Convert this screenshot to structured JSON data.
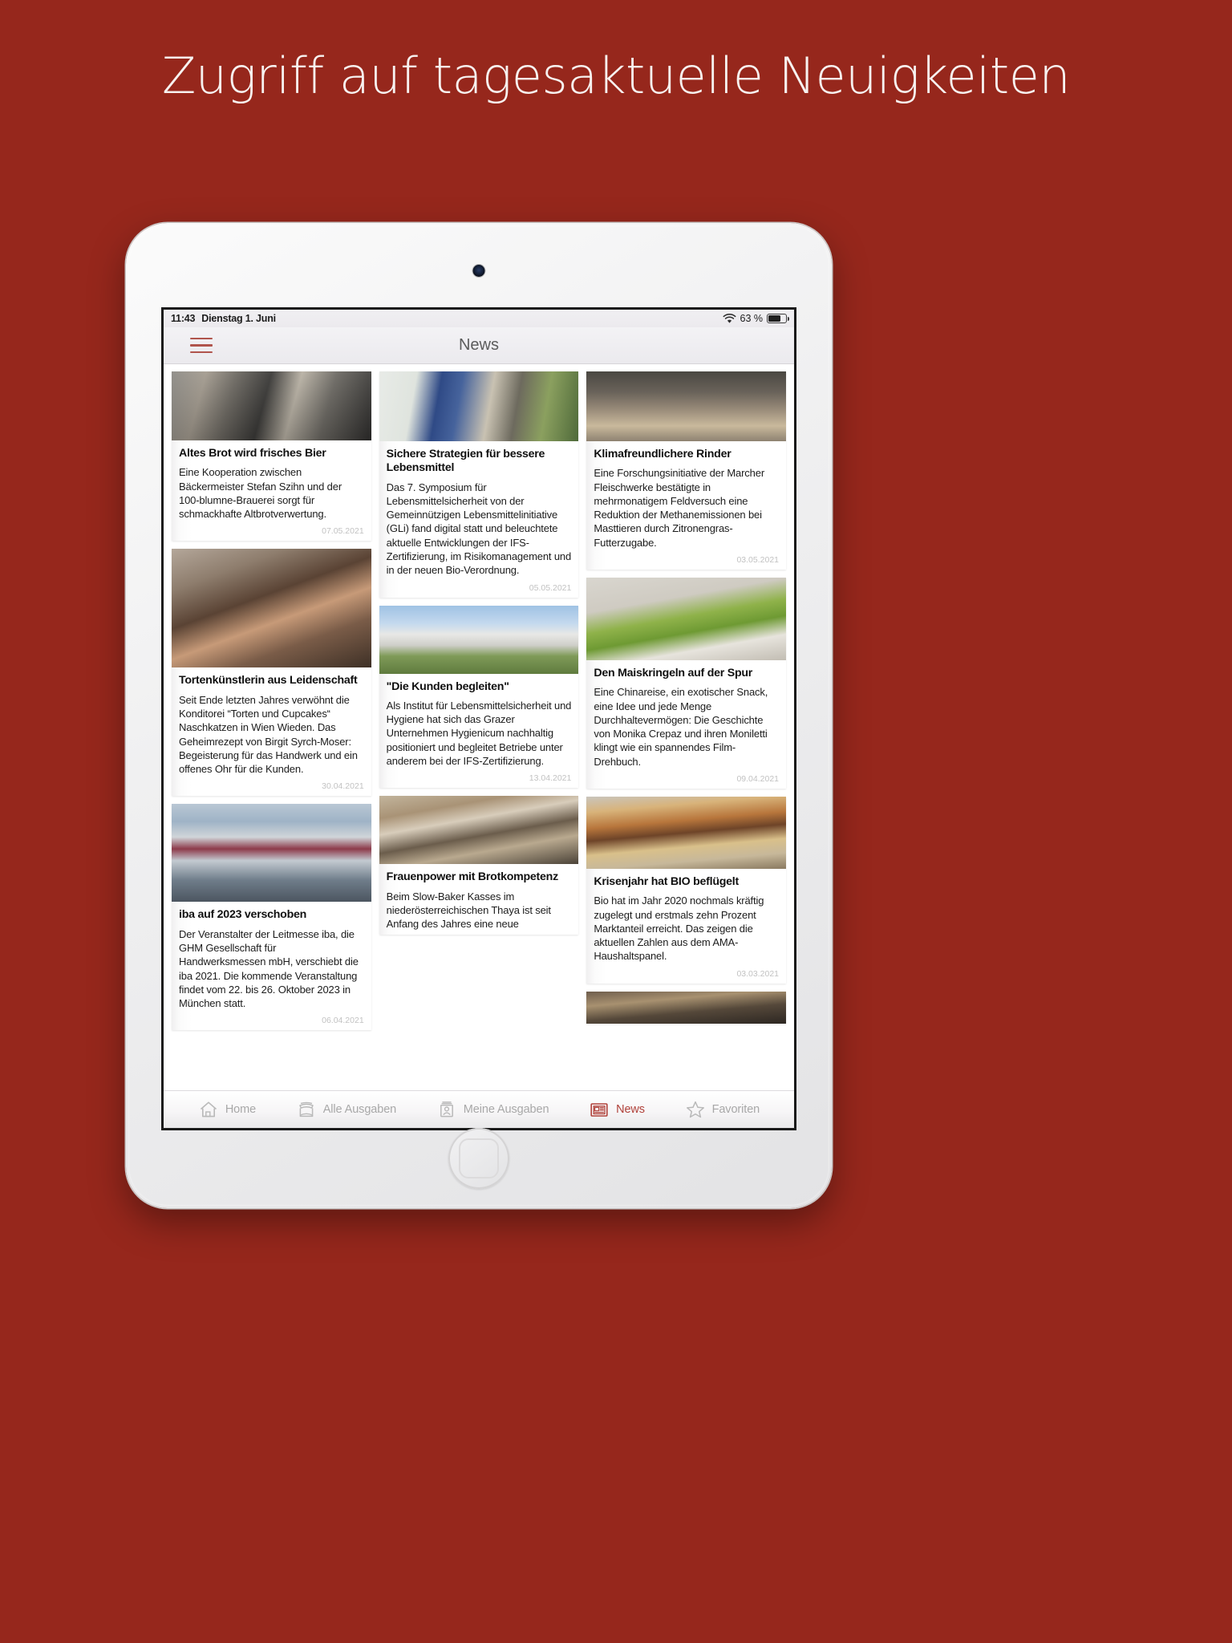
{
  "promo": {
    "headline": "Zugriff auf tagesaktuelle Neuigkeiten",
    "background_color": "#96271c",
    "headline_color": "#f7f2f0"
  },
  "statusbar": {
    "time": "11:43",
    "date": "Dienstag 1. Juni",
    "wifi_icon": "wifi-icon",
    "battery_percent": "63 %",
    "battery_icon": "battery-icon"
  },
  "navbar": {
    "menu_icon": "hamburger-menu-icon",
    "title": "News",
    "menu_color": "#b0544c"
  },
  "articles": {
    "column1": [
      {
        "image": "ph-beer",
        "image_alt": "two-men-shaking-hands-with-beer-bottle",
        "title": "Altes Brot wird frisches Bier",
        "text": "Eine Kooperation zwischen Bäckermeister Stefan Szihn und der 100-blumne-Brauerei sorgt für schmackhafte Altbrotverwertung.",
        "date": "07.05.2021"
      },
      {
        "image": "ph-portrait",
        "image_alt": "portrait-of-woman-baker",
        "title": "Tortenkünstlerin aus Leidenschaft",
        "text": "Seit Ende letzten Jahres verwöhnt die Konditorei “Torten und Cupcakes“ Naschkatzen in Wien Wieden. Das Geheimrezept von Birgit Syrch-Moser: Begeisterung für das Handwerk und ein offenes Ohr für die Kunden.",
        "date": "30.04.2021"
      },
      {
        "image": "ph-expo",
        "image_alt": "trade-fair-building-with-flags",
        "title": "iba auf 2023 verschoben",
        "text": "Der Veranstalter der Leitmesse iba, die GHM Gesellschaft für Handwerksmessen mbH, verschiebt die iba 2021. Die kommende Veranstaltung findet vom 22. bis 26. Oktober 2023 in München statt.",
        "date": "06.04.2021"
      }
    ],
    "column2": [
      {
        "image": "ph-gli",
        "image_alt": "two-men-in-front-of-gli-banner",
        "title": "Sichere Strategien für bessere Lebensmittel",
        "text": "Das 7. Symposium für Lebensmittelsicherheit von der Gemeinnützigen Lebensmittelinitiative (GLi) fand digital statt und beleuchtete aktuelle Entwicklungen der IFS-Zertifizierung, im Risikomanagement und in der neuen Bio-Verordnung.",
        "date": "05.05.2021"
      },
      {
        "image": "ph-building",
        "image_alt": "modern-office-building-exterior",
        "title": "\"Die Kunden begleiten\"",
        "text": "Als Institut für Lebensmittelsicherheit und Hygiene hat sich das Grazer  Unternehmen Hygienicum nachhaltig positioniert und begleitet Betriebe unter anderem bei der IFS-Zertifizierung.",
        "date": "13.04.2021"
      },
      {
        "image": "ph-bakery",
        "image_alt": "people-in-bakery-shop",
        "title": "Frauenpower mit Brotkompetenz",
        "text": "Beim Slow-Baker Kasses im niederösterreichischen Thaya ist seit Anfang des Jahres eine neue",
        "date": ""
      }
    ],
    "column3": [
      {
        "image": "ph-cows",
        "image_alt": "cows-in-barn-feeding",
        "title": "Klimafreundlichere Rinder",
        "text": "Eine Forschungsinitiative der Marcher Fleischwerke bestätigte in mehrmonatigem Feldversuch eine Reduktion der Methanemissionen bei Masttieren durch Zitronengras-Futterzugabe.",
        "date": "03.05.2021"
      },
      {
        "image": "ph-greenteam",
        "image_alt": "team-in-green-shirts-group-photo",
        "title": "Den Maiskringeln auf der Spur",
        "text": "Eine Chinareise, ein exotischer Snack, eine Idee und jede Menge Durchhaltevermögen: Die Geschichte von Monika Crepaz und ihren Moniletti klingt wie ein spannendes Film-Drehbuch.",
        "date": "09.04.2021"
      },
      {
        "image": "ph-burger",
        "image_alt": "burger-with-chips-in-basket",
        "title": "Krisenjahr hat BIO beflügelt",
        "text": "Bio hat im Jahr 2020 nochmals kräftig zugelegt und erstmals zehn Prozent Marktanteil erreicht. Das zeigen die aktuellen Zahlen aus dem AMA-Haushaltspanel.",
        "date": "03.03.2021"
      },
      {
        "image": "ph-cut",
        "image_alt": "partially-visible-next-article-image",
        "title": "",
        "text": "",
        "date": ""
      }
    ]
  },
  "tabbar": {
    "active_color": "#b0413a",
    "inactive_color": "#a8a8a8",
    "items": [
      {
        "icon": "home-icon",
        "label": "Home",
        "active": false
      },
      {
        "icon": "kiosk-icon",
        "label": "Alle Ausgaben",
        "active": false
      },
      {
        "icon": "person-card-icon",
        "label": "Meine Ausgaben",
        "active": false
      },
      {
        "icon": "newspaper-icon",
        "label": "News",
        "active": true
      },
      {
        "icon": "star-icon",
        "label": "Favoriten",
        "active": false
      }
    ]
  }
}
